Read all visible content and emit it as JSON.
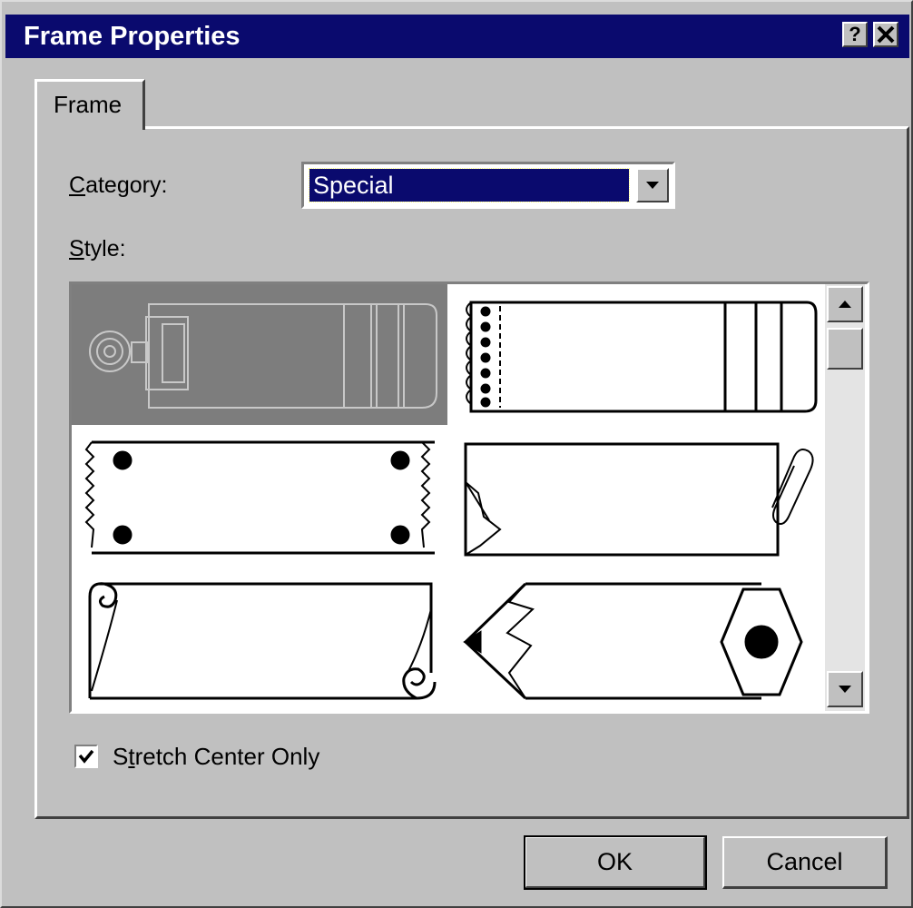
{
  "window": {
    "title": "Frame Properties",
    "help_glyph": "?",
    "close_glyph": "✕"
  },
  "tabs": [
    {
      "label": "Frame",
      "active": true
    }
  ],
  "category": {
    "label_first": "C",
    "label_rest": "ategory:",
    "value": "Special"
  },
  "style": {
    "label_first": "S",
    "label_rest": "tyle:",
    "items": [
      {
        "name": "binder-clip-frame",
        "selected": true
      },
      {
        "name": "spiral-notebook-frame",
        "selected": false
      },
      {
        "name": "torn-tape-frame",
        "selected": false
      },
      {
        "name": "paperclip-frame",
        "selected": false
      },
      {
        "name": "scroll-frame",
        "selected": false
      },
      {
        "name": "pencil-frame",
        "selected": false
      }
    ]
  },
  "stretch_center_only": {
    "label_before": "S",
    "label_underlined": "t",
    "label_after": "retch Center Only",
    "checked": true
  },
  "buttons": {
    "ok": "OK",
    "cancel": "Cancel"
  },
  "colors": {
    "titlebar": "#0a0a6e",
    "dialog_face": "#c0c0c0",
    "selection": "#7d7d7d"
  }
}
